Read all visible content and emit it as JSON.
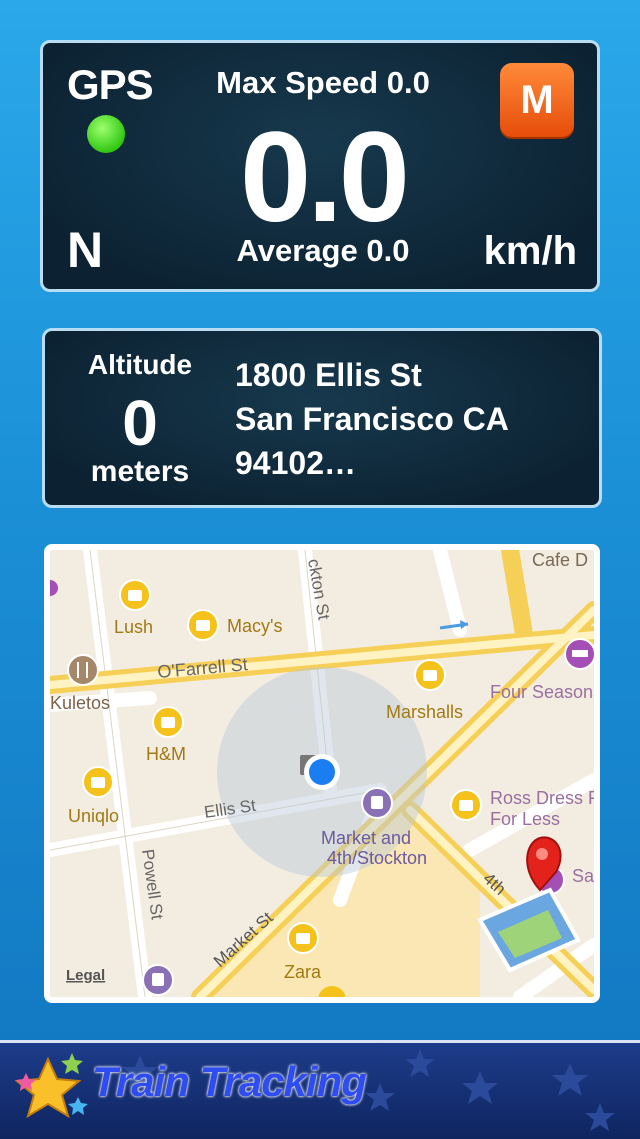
{
  "speed_panel": {
    "gps_label": "GPS",
    "gps_status_color": "#32c814",
    "max_speed_label": "Max Speed 0.0",
    "speed": "0.0",
    "average_label": "Average 0.0",
    "heading": "N",
    "unit": "km/h",
    "mode_button": "M"
  },
  "altitude_panel": {
    "label": "Altitude",
    "value": "0",
    "unit": "meters",
    "address_lines": [
      "1800 Ellis St",
      "San Francisco CA",
      "94102…"
    ]
  },
  "map": {
    "streets": [
      "ckton St",
      "O'Farrell St",
      "Ellis St",
      "Powell St",
      "Market St",
      "4th"
    ],
    "places": [
      "Lush",
      "Macy's",
      "Kuletos",
      "H&M",
      "Uniqlo",
      "Marshalls",
      "Zara",
      "Cafe D",
      "Four Seasons San Fran",
      "Ross Dress For Less",
      "Sa Ma"
    ],
    "transit": [
      "Market and",
      "4th/Stockton"
    ],
    "legal": "Legal"
  },
  "bottom": {
    "title": "Train Tracking"
  }
}
